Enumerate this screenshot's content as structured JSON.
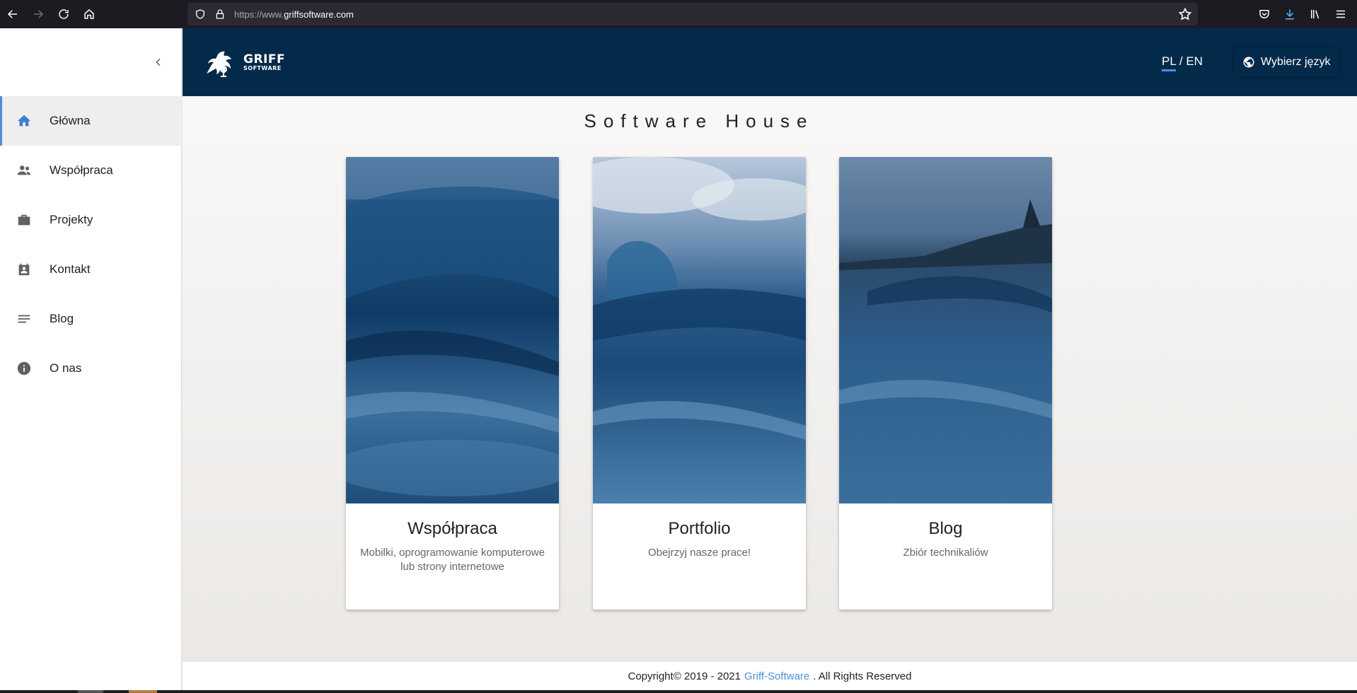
{
  "browser": {
    "url_prefix": "https://www.",
    "url_domain": "griffsoftware.com"
  },
  "sidebar": {
    "items": [
      {
        "label": "Główna",
        "icon": "home-icon",
        "active": true
      },
      {
        "label": "Współpraca",
        "icon": "people-icon"
      },
      {
        "label": "Projekty",
        "icon": "briefcase-icon"
      },
      {
        "label": "Kontakt",
        "icon": "contact-card-icon"
      },
      {
        "label": "Blog",
        "icon": "lines-icon"
      },
      {
        "label": "O nas",
        "icon": "info-icon"
      }
    ]
  },
  "header": {
    "logo_big": "GRIFF",
    "logo_small": "SOFTWARE",
    "lang_pl": "PL",
    "lang_sep": " / ",
    "lang_en": "EN",
    "lang_select_label": "Wybierz język"
  },
  "main": {
    "title": "Software House",
    "cards": [
      {
        "title": "Współpraca",
        "subtitle": "Mobilki, oprogramowanie komputerowe lub strony internetowe"
      },
      {
        "title": "Portfolio",
        "subtitle": "Obejrzyj nasze prace!"
      },
      {
        "title": "Blog",
        "subtitle": "Zbiór technikaliów"
      }
    ]
  },
  "footer": {
    "copyright": "Copyright© 2019 - 2021",
    "link": "Griff-Software",
    "rights": ". All Rights Reserved"
  },
  "colors": {
    "header_bg": "#042a4b",
    "accent": "#4a90d9",
    "browser_bg": "#1c1b22"
  }
}
